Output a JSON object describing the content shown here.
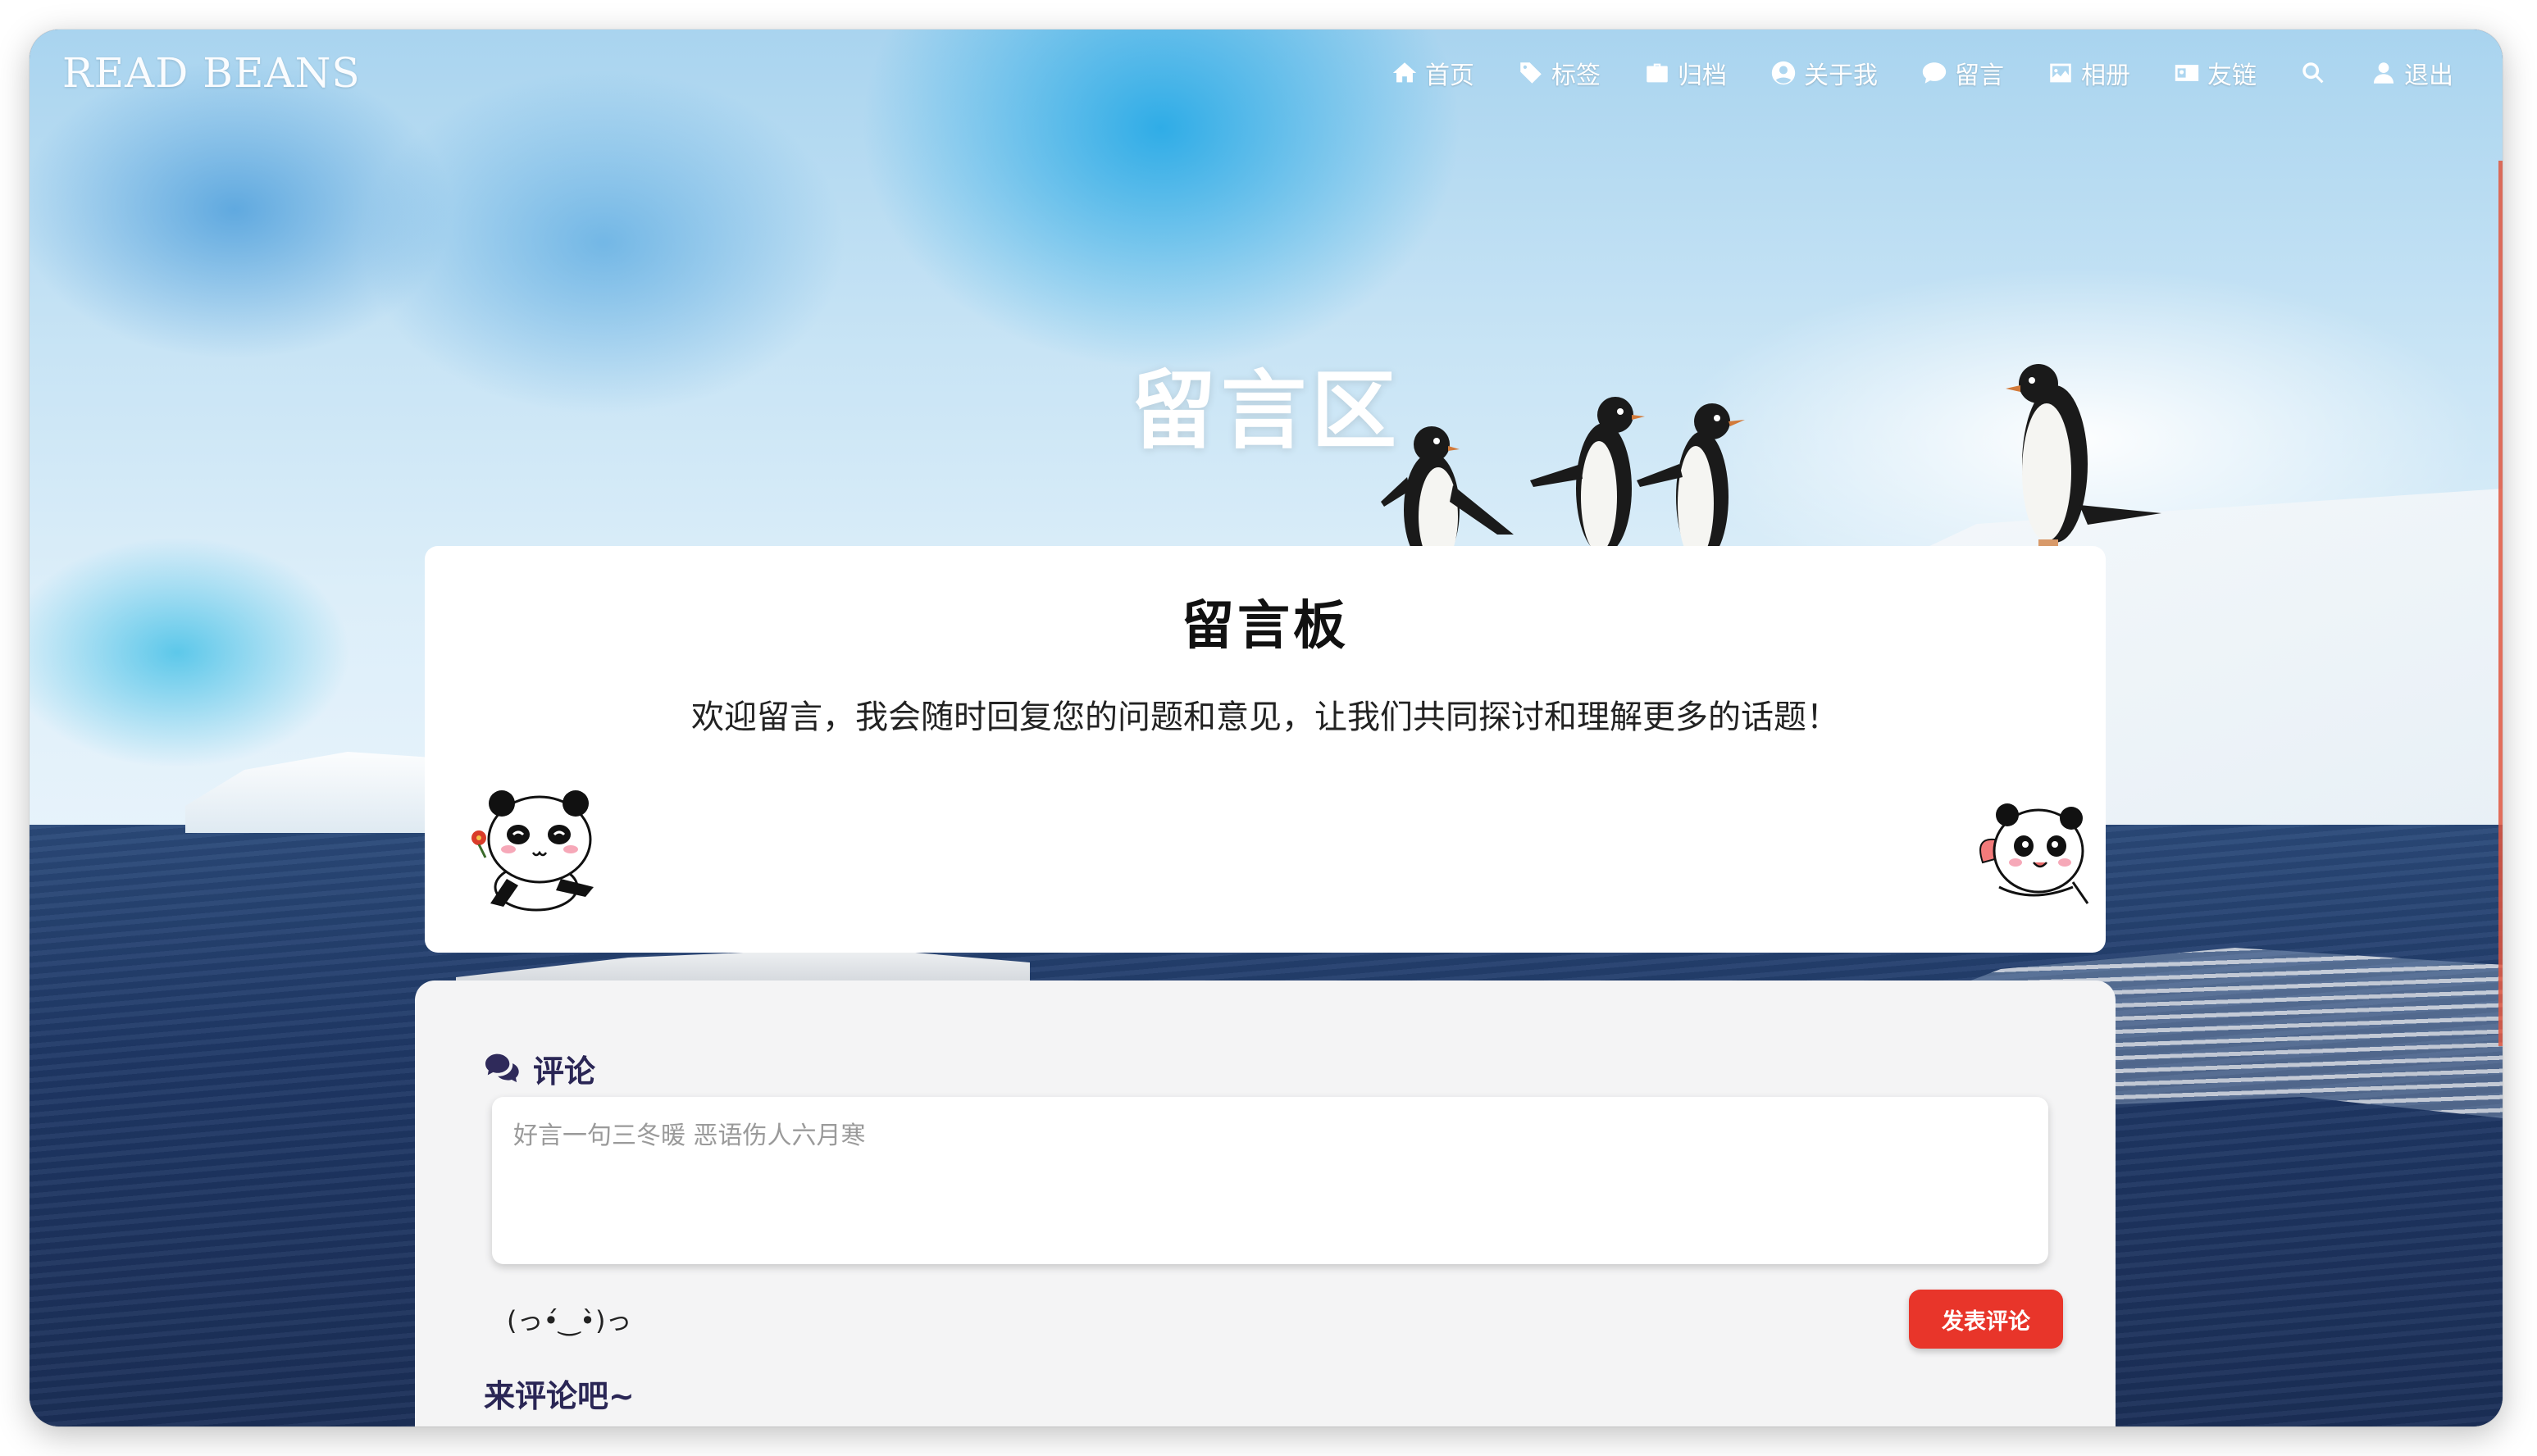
{
  "header": {
    "logo": "READ BEANS",
    "nav": [
      {
        "label": "首页",
        "icon": "home-icon"
      },
      {
        "label": "标签",
        "icon": "tag-icon"
      },
      {
        "label": "归档",
        "icon": "briefcase-icon"
      },
      {
        "label": "关于我",
        "icon": "user-circle-icon"
      },
      {
        "label": "留言",
        "icon": "comment-icon"
      },
      {
        "label": "相册",
        "icon": "image-icon"
      },
      {
        "label": "友链",
        "icon": "id-card-icon"
      },
      {
        "label": "",
        "icon": "search-icon"
      },
      {
        "label": "退出",
        "icon": "user-icon"
      }
    ]
  },
  "hero": {
    "title": "留言区"
  },
  "board": {
    "title": "留言板",
    "description": "欢迎留言，我会随时回复您的问题和意见，让我们共同探讨和理解更多的话题！"
  },
  "comments": {
    "heading": "评论",
    "placeholder": "好言一句三冬暖 恶语伤人六月寒",
    "emoji_label": "(っ•́‿•̀)っ",
    "submit_label": "发表评论",
    "empty_hint": "来评论吧~"
  },
  "colors": {
    "accent": "#e8352a",
    "heading": "#2a2655",
    "card_bg": "#f4f4f5"
  }
}
